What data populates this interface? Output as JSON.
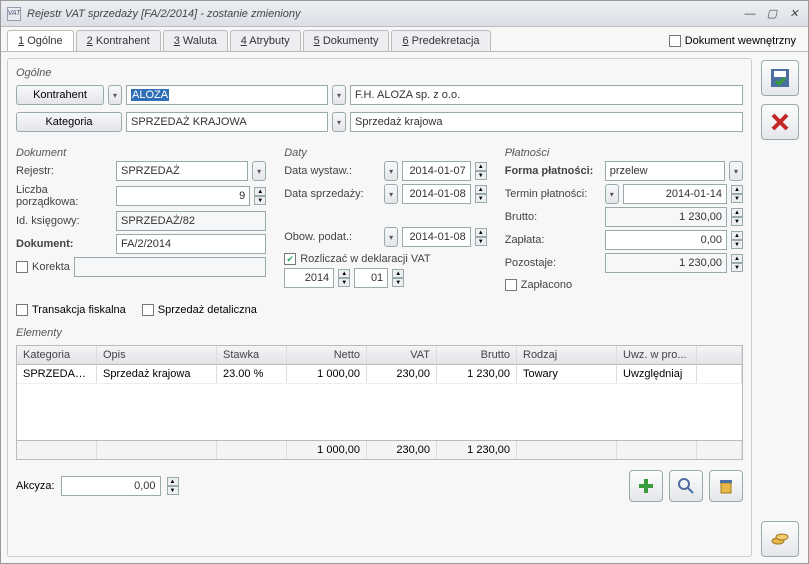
{
  "window": {
    "title": "Rejestr VAT sprzedaży [FA/2/2014] - zostanie zmieniony"
  },
  "header": {
    "internalDoc": "Dokument wewnętrzny"
  },
  "tabs": [
    {
      "key": "1",
      "label": "Ogólne"
    },
    {
      "key": "2",
      "label": "Kontrahent"
    },
    {
      "key": "3",
      "label": "Waluta"
    },
    {
      "key": "4",
      "label": "Atrybuty"
    },
    {
      "key": "5",
      "label": "Dokumenty"
    },
    {
      "key": "6",
      "label": "Predekretacja"
    }
  ],
  "sections": {
    "general": "Ogólne",
    "dokument": "Dokument",
    "daty": "Daty",
    "platnosci": "Płatności",
    "elementy": "Elementy"
  },
  "general": {
    "kontrahentBtn": "Kontrahent",
    "kontrahentCode": "ALOZA",
    "kontrahentName": "F.H. ALOZA sp. z o.o.",
    "kategoriaBtn": "Kategoria",
    "kategoriaCode": "SPRZEDAŻ KRAJOWA",
    "kategoriaName": "Sprzedaż krajowa"
  },
  "dokument": {
    "rejestrLabel": "Rejestr:",
    "rejestr": "SPRZEDAŻ",
    "lpLabel": "Liczba porządkowa:",
    "lp": "9",
    "idkLabel": "Id. księgowy:",
    "idk": "SPRZEDAŻ/82",
    "docLabel": "Dokument:",
    "doc": "FA/2/2014",
    "korektaLabel": "Korekta"
  },
  "daty": {
    "wystawLabel": "Data wystaw.:",
    "wystaw": "2014-01-07",
    "sprzedLabel": "Data sprzedaży:",
    "sprzed": "2014-01-08",
    "obowLabel": "Obow. podat.:",
    "obow": "2014-01-08",
    "rozliczacLabel": "Rozliczać w deklaracji VAT",
    "deklYear": "2014",
    "deklMonth": "01"
  },
  "platnosci": {
    "formaLabel": "Forma płatności:",
    "forma": "przelew",
    "terminLabel": "Termin płatności:",
    "termin": "2014-01-14",
    "bruttoLabel": "Brutto:",
    "brutto": "1 230,00",
    "zaplataLabel": "Zapłata:",
    "zaplata": "0,00",
    "pozostajeLabel": "Pozostaje:",
    "pozostaje": "1 230,00",
    "zaplaconoLabel": "Zapłacono"
  },
  "options": {
    "fiscal": "Transakcja fiskalna",
    "detal": "Sprzedaż detaliczna"
  },
  "table": {
    "headers": [
      "Kategoria",
      "Opis",
      "Stawka",
      "Netto",
      "VAT",
      "Brutto",
      "Rodzaj",
      "Uwz. w pro..."
    ],
    "rows": [
      {
        "kategoria": "SPRZEDAŻ ...",
        "opis": "Sprzedaż krajowa",
        "stawka": "23.00 %",
        "netto": "1 000,00",
        "vat": "230,00",
        "brutto": "1 230,00",
        "rodzaj": "Towary",
        "uwz": "Uwzględniaj"
      }
    ],
    "totals": {
      "netto": "1 000,00",
      "vat": "230,00",
      "brutto": "1 230,00"
    }
  },
  "footer": {
    "akcyzaLabel": "Akcyza:",
    "akcyza": "0,00"
  }
}
